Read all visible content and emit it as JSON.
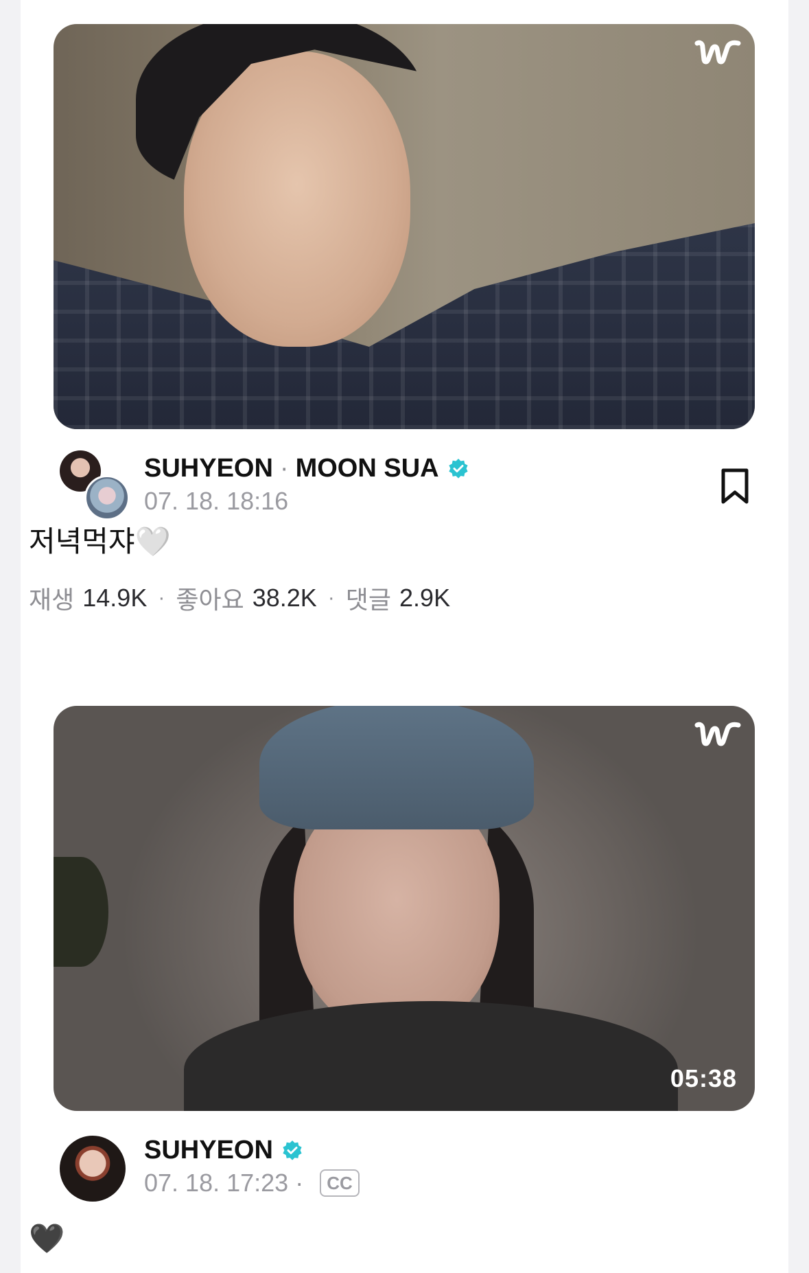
{
  "colors": {
    "verified": "#2bc3d1",
    "muted_text": "#9a9aa0",
    "primary_text": "#111111"
  },
  "posts": [
    {
      "thumbnail_badge_icon": "weverse-w-logo-icon",
      "authors": [
        "SUHYEON",
        "MOON SUA"
      ],
      "author_separator": "·",
      "verified": true,
      "date": "07. 18. 18:16",
      "caption": "저녁먹쟈🤍",
      "stats": {
        "plays_label": "재생",
        "plays_value": "14.9K",
        "likes_label": "좋아요",
        "likes_value": "38.2K",
        "comments_label": "댓글",
        "comments_value": "2.9K",
        "separator": "·"
      },
      "bookmark_icon": "bookmark-icon"
    },
    {
      "thumbnail_badge_icon": "weverse-w-logo-icon",
      "duration": "05:38",
      "authors": [
        "SUHYEON"
      ],
      "verified": true,
      "date": "07. 18. 17:23",
      "date_separator": "·",
      "cc_label": "CC",
      "caption": "🖤"
    }
  ]
}
